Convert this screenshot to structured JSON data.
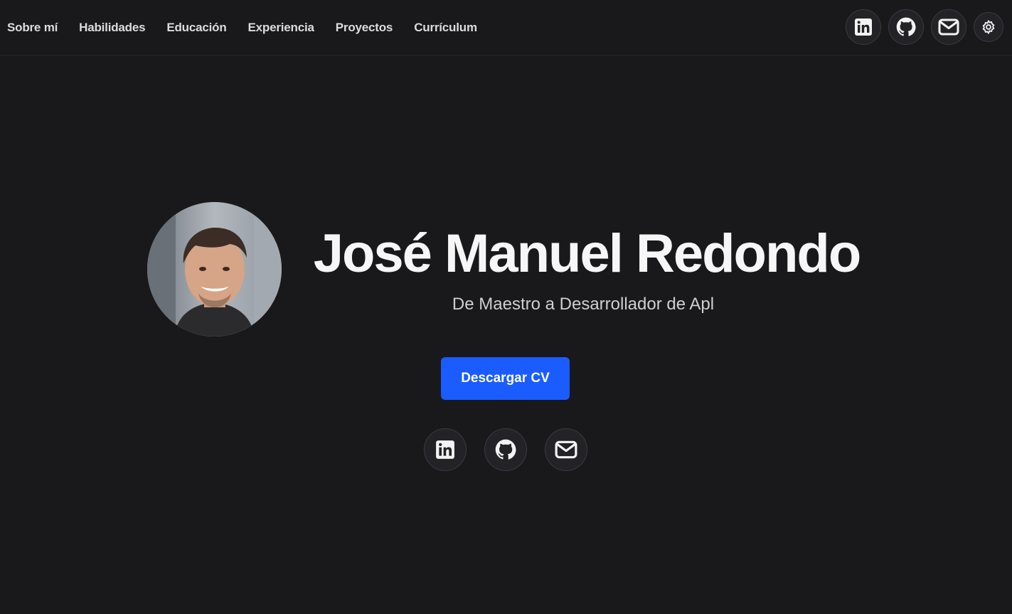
{
  "nav": {
    "items": [
      {
        "label": "Sobre mí"
      },
      {
        "label": "Habilidades"
      },
      {
        "label": "Educación"
      },
      {
        "label": "Experiencia"
      },
      {
        "label": "Proyectos"
      },
      {
        "label": "Currículum"
      }
    ],
    "icons": [
      "linkedin-icon",
      "github-icon",
      "mail-icon",
      "gear-icon"
    ]
  },
  "hero": {
    "name": "José Manuel Redondo",
    "subtitle": "De Maestro a Desarrollador de Apl",
    "cv_button": "Descargar CV",
    "social_icons": [
      "linkedin-icon",
      "github-icon",
      "mail-icon"
    ]
  },
  "colors": {
    "background": "#19181b",
    "accent": "#1a5cff",
    "text": "#f6f6f7"
  }
}
